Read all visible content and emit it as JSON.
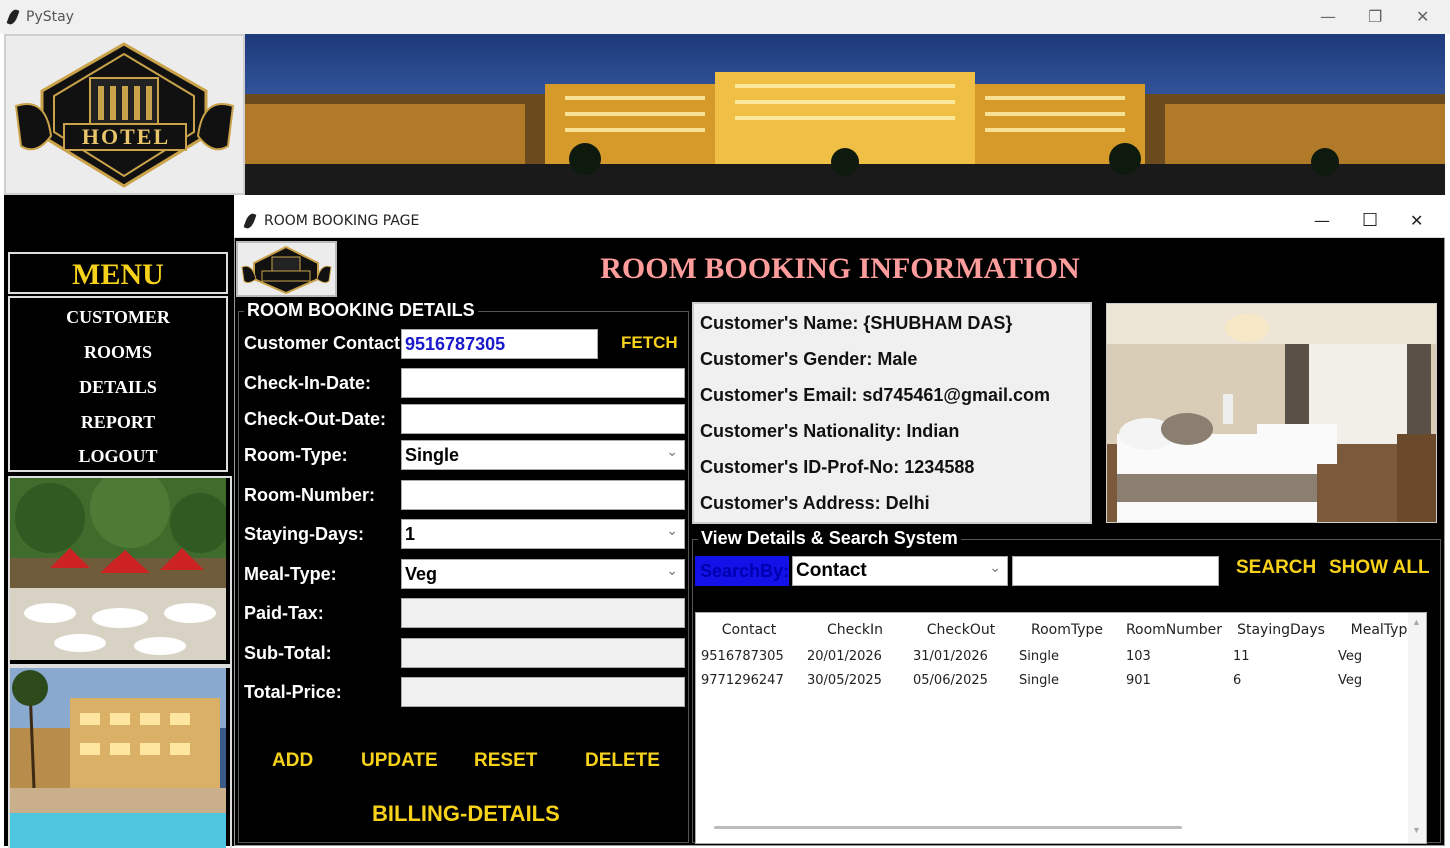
{
  "app": {
    "title": "PyStay",
    "window_buttons": {
      "minimize": "—",
      "maximize": "❐",
      "close": "✕"
    }
  },
  "logo": {
    "text": "HOTEL"
  },
  "menu": {
    "title": "MENU",
    "items": [
      "CUSTOMER",
      "ROOMS",
      "DETAILS",
      "REPORT",
      "LOGOUT"
    ]
  },
  "booking_window": {
    "title": "ROOM BOOKING PAGE",
    "window_buttons": {
      "minimize": "—",
      "maximize": "☐",
      "close": "✕"
    },
    "header_title": "ROOM BOOKING INFORMATION",
    "details_group_label": "ROOM BOOKING DETAILS",
    "fields": {
      "customer_contact": {
        "label": "Customer Contact:",
        "value": "9516787305"
      },
      "fetch_label": "FETCH",
      "check_in": {
        "label": "Check-In-Date:",
        "value": ""
      },
      "check_out": {
        "label": "Check-Out-Date:",
        "value": ""
      },
      "room_type": {
        "label": "Room-Type:",
        "value": "Single"
      },
      "room_number": {
        "label": "Room-Number:",
        "value": ""
      },
      "staying_days": {
        "label": "Staying-Days:",
        "value": "1"
      },
      "meal_type": {
        "label": "Meal-Type:",
        "value": "Veg"
      },
      "paid_tax": {
        "label": "Paid-Tax:",
        "value": ""
      },
      "sub_total": {
        "label": "Sub-Total:",
        "value": ""
      },
      "total_price": {
        "label": "Total-Price:",
        "value": ""
      }
    },
    "buttons": {
      "add": "ADD",
      "update": "UPDATE",
      "reset": "RESET",
      "delete": "DELETE",
      "billing": "BILLING-DETAILS"
    },
    "customer_info": [
      "Customer's Name:  {SHUBHAM DAS}",
      "Customer's Gender:  Male",
      "Customer's Email:   sd745461@gmail.com",
      "Customer's Nationality:  Indian",
      "Customer's ID-Prof-No:  1234588",
      "Customer's Address:  Delhi"
    ],
    "search": {
      "group_label": "View Details & Search System",
      "search_by_label": "SearchBy:",
      "search_by_value": "Contact",
      "search_value": "",
      "search_button": "SEARCH",
      "show_all_button": "SHOW ALL"
    },
    "table": {
      "columns": [
        "Contact",
        "CheckIn",
        "CheckOut",
        "RoomType",
        "RoomNumber",
        "StayingDays",
        "MealTyp"
      ],
      "rows": [
        [
          "9516787305",
          "20/01/2026",
          "31/01/2026",
          "Single",
          "103",
          "11",
          "Veg"
        ],
        [
          "9771296247",
          "30/05/2025",
          "05/06/2025",
          "Single",
          "901",
          "6",
          "Veg"
        ]
      ]
    }
  },
  "colors": {
    "accent_yellow": "#f7d21b",
    "title_pink": "#ff9d9d",
    "searchby_blue": "#1212e8",
    "background_black": "#000000"
  }
}
